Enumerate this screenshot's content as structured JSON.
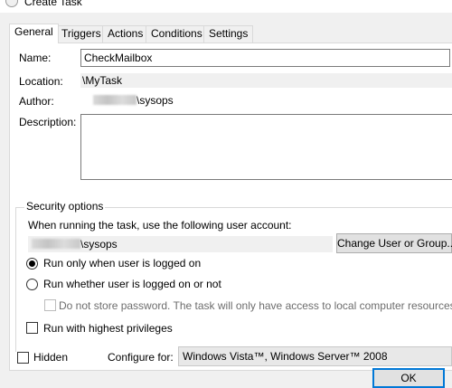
{
  "window": {
    "title": "Create Task"
  },
  "tabs": [
    {
      "label": "General",
      "active": true
    },
    {
      "label": "Triggers"
    },
    {
      "label": "Actions"
    },
    {
      "label": "Conditions"
    },
    {
      "label": "Settings"
    }
  ],
  "general": {
    "name_label": "Name:",
    "name_value": "CheckMailbox",
    "location_label": "Location:",
    "location_value": "\\MyTask",
    "author_label": "Author:",
    "author_value": "\\sysops",
    "description_label": "Description:",
    "description_value": ""
  },
  "security": {
    "group_title": "Security options",
    "account_prompt": "When running the task, use the following user account:",
    "account_value": "\\sysops",
    "change_user_button": "Change User or Group...",
    "radio_logged_on": "Run only when user is logged on",
    "radio_whether": "Run whether user is logged on or not",
    "no_store_password": "Do not store password.  The task will only have access to local computer resources.",
    "highest_privileges": "Run with highest privileges"
  },
  "bottom": {
    "hidden_label": "Hidden",
    "configure_label": "Configure for:",
    "configure_value": "Windows Vista™, Windows Server™ 2008",
    "ok_button": "OK"
  }
}
